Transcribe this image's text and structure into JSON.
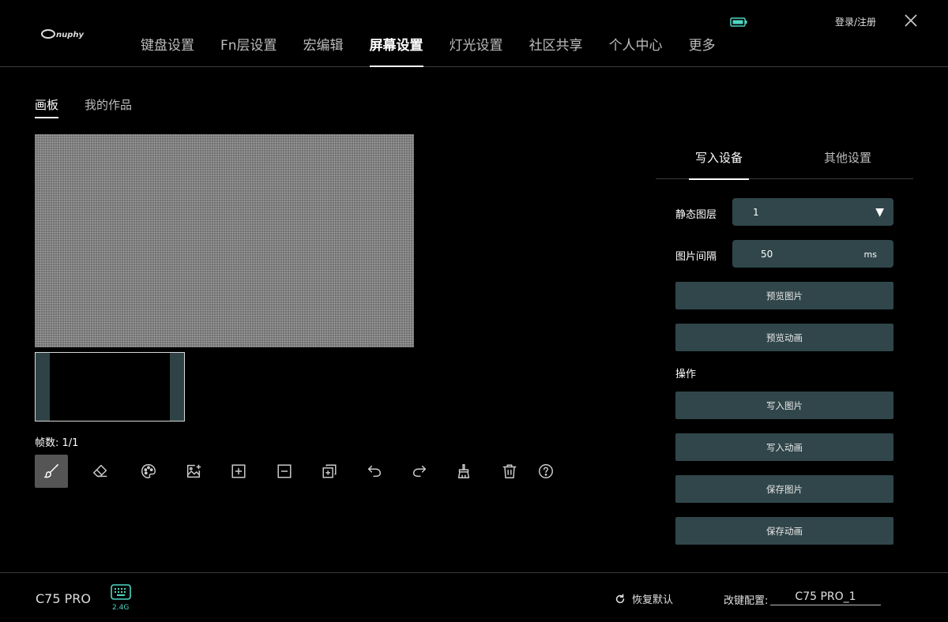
{
  "header": {
    "brand": "nuphy",
    "nav": [
      {
        "label": "键盘设置"
      },
      {
        "label": "Fn层设置"
      },
      {
        "label": "宏编辑"
      },
      {
        "label": "屏幕设置"
      },
      {
        "label": "灯光设置"
      },
      {
        "label": "社区共享"
      },
      {
        "label": "个人中心"
      },
      {
        "label": "更多"
      }
    ],
    "active_nav": "屏幕设置",
    "login": "登录/注册",
    "battery_color": "#4fd6c2"
  },
  "subtabs": [
    {
      "label": "画板"
    },
    {
      "label": "我的作品"
    }
  ],
  "frames": "帧数: 1/1",
  "tools": [
    "brush-icon",
    "eraser-icon",
    "palette-icon",
    "image-import-icon",
    "add-frame-icon",
    "remove-frame-icon",
    "copy-frame-icon",
    "undo-icon",
    "redo-icon",
    "clear-icon",
    "delete-icon",
    "help-icon"
  ],
  "right": {
    "tabs": [
      {
        "label": "写入设备"
      },
      {
        "label": "其他设置"
      }
    ],
    "static_layer_label": "静态图层",
    "static_layer_value": "1",
    "interval_label": "图片间隔",
    "interval_value": "50",
    "interval_unit": "ms",
    "preview_image": "预览图片",
    "preview_animation": "预览动画",
    "ops_label": "操作",
    "write_image": "写入图片",
    "write_animation": "写入动画",
    "save_image": "保存图片",
    "save_animation": "保存动画"
  },
  "footer": {
    "model": "C75 PRO",
    "connection": "2.4G",
    "restore": "恢复默认",
    "config_label": "改键配置:",
    "config_value": "C75 PRO_1"
  },
  "colors": {
    "accent": "#4fd6c2",
    "button_bg": "#30464a",
    "canvas_bg": "#6a6a6a"
  }
}
